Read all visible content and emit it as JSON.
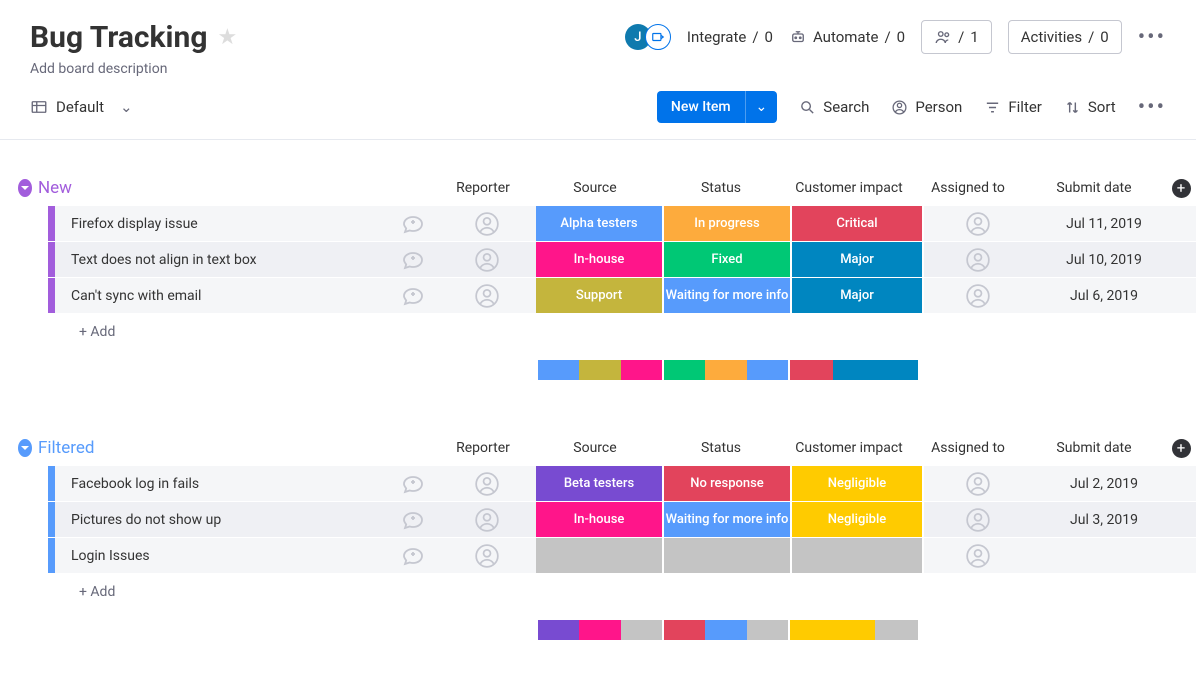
{
  "board": {
    "title": "Bug Tracking",
    "description_placeholder": "Add board description"
  },
  "header": {
    "avatar_letter": "J",
    "integrate": {
      "label": "Integrate",
      "count": "0"
    },
    "automate": {
      "label": "Automate",
      "count": "0"
    },
    "members_count": "1",
    "activities": {
      "label": "Activities",
      "count": "0"
    }
  },
  "toolbar": {
    "view_label": "Default",
    "new_item": "New Item",
    "search": "Search",
    "person": "Person",
    "filter": "Filter",
    "sort": "Sort"
  },
  "columns": {
    "reporter": "Reporter",
    "source": "Source",
    "status": "Status",
    "impact": "Customer impact",
    "assigned": "Assigned to",
    "date": "Submit date"
  },
  "add_row_label": "+ Add",
  "colors": {
    "purple_group": "#a25ddc",
    "blue_group": "#579bfc",
    "alpha": "#579bfc",
    "inhouse": "#e2445c",
    "support": "#c4b53d",
    "beta": "#784bd1",
    "inprogress": "#fdab3d",
    "fixed": "#00c875",
    "waiting": "#579bfc",
    "noresponse": "#e2445c",
    "critical": "#e2445c",
    "major": "#0086c0",
    "negligible": "#ffcb00",
    "inhouse_pink": "#ff158a"
  },
  "groups": [
    {
      "name": "New",
      "color": "#a25ddc",
      "rows": [
        {
          "name": "Firefox display issue",
          "source": {
            "text": "Alpha testers",
            "color": "#579bfc"
          },
          "status": {
            "text": "In progress",
            "color": "#fdab3d"
          },
          "impact": {
            "text": "Critical",
            "color": "#e2445c"
          },
          "date": "Jul 11, 2019"
        },
        {
          "name": "Text does not align in text box",
          "source": {
            "text": "In-house",
            "color": "#ff158a"
          },
          "status": {
            "text": "Fixed",
            "color": "#00c875"
          },
          "impact": {
            "text": "Major",
            "color": "#0086c0"
          },
          "date": "Jul 10, 2019"
        },
        {
          "name": "Can't sync with email",
          "source": {
            "text": "Support",
            "color": "#c4b53d"
          },
          "status": {
            "text": "Waiting for more info",
            "color": "#579bfc"
          },
          "impact": {
            "text": "Major",
            "color": "#0086c0"
          },
          "date": "Jul 6, 2019"
        }
      ],
      "summary": {
        "source": [
          {
            "color": "#579bfc",
            "w": 42
          },
          {
            "color": "#c4b53d",
            "w": 42
          },
          {
            "color": "#ff158a",
            "w": 42
          }
        ],
        "status": [
          {
            "color": "#00c875",
            "w": 42
          },
          {
            "color": "#fdab3d",
            "w": 42
          },
          {
            "color": "#579bfc",
            "w": 42
          }
        ],
        "impact": [
          {
            "color": "#e2445c",
            "w": 43
          },
          {
            "color": "#0086c0",
            "w": 85
          }
        ]
      }
    },
    {
      "name": "Filtered",
      "color": "#579bfc",
      "rows": [
        {
          "name": "Facebook log in fails",
          "source": {
            "text": "Beta testers",
            "color": "#784bd1"
          },
          "status": {
            "text": "No response",
            "color": "#e2445c"
          },
          "impact": {
            "text": "Negligible",
            "color": "#ffcb00"
          },
          "date": "Jul 2, 2019"
        },
        {
          "name": "Pictures do not show up",
          "source": {
            "text": "In-house",
            "color": "#ff158a"
          },
          "status": {
            "text": "Waiting for more info",
            "color": "#579bfc"
          },
          "impact": {
            "text": "Negligible",
            "color": "#ffcb00"
          },
          "date": "Jul 3, 2019"
        },
        {
          "name": "Login Issues",
          "source": {
            "text": "",
            "color": "#c4c4c4"
          },
          "status": {
            "text": "",
            "color": "#c4c4c4"
          },
          "impact": {
            "text": "",
            "color": "#c4c4c4"
          },
          "date": ""
        }
      ],
      "summary": {
        "source": [
          {
            "color": "#784bd1",
            "w": 42
          },
          {
            "color": "#ff158a",
            "w": 42
          },
          {
            "color": "#c4c4c4",
            "w": 42
          }
        ],
        "status": [
          {
            "color": "#e2445c",
            "w": 42
          },
          {
            "color": "#579bfc",
            "w": 42
          },
          {
            "color": "#c4c4c4",
            "w": 42
          }
        ],
        "impact": [
          {
            "color": "#ffcb00",
            "w": 85
          },
          {
            "color": "#c4c4c4",
            "w": 43
          }
        ]
      }
    }
  ]
}
